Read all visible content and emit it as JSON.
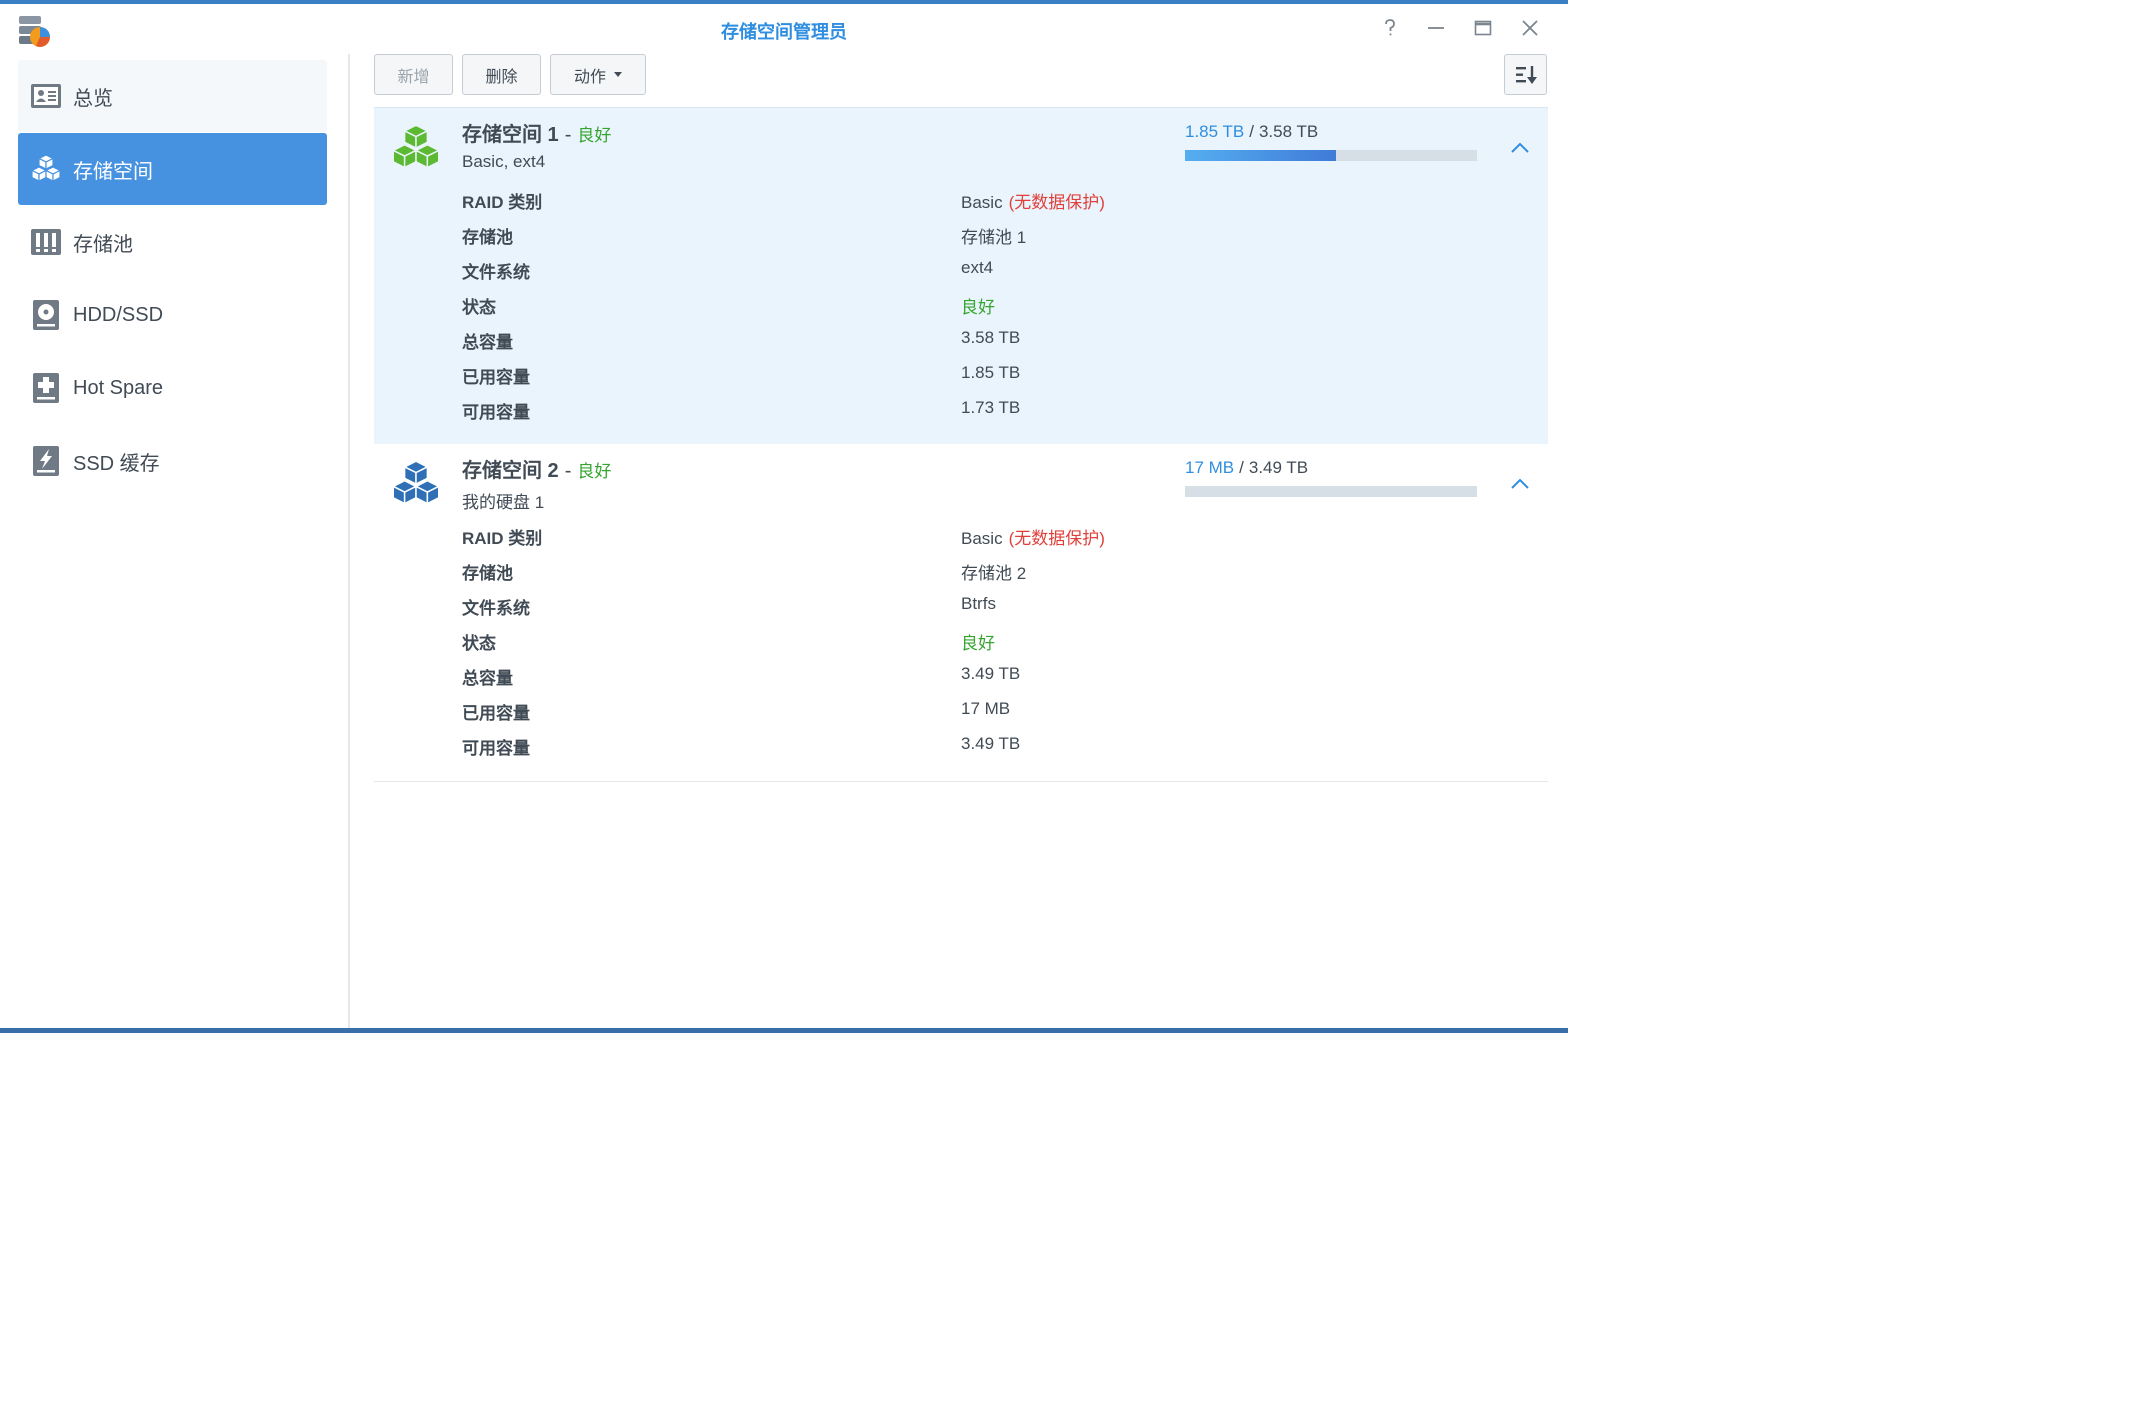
{
  "window": {
    "title": "存储空间管理员"
  },
  "sidebar": {
    "items": [
      {
        "label": "总览",
        "icon": "overview-icon"
      },
      {
        "label": "存储空间",
        "icon": "volume-icon"
      },
      {
        "label": "存储池",
        "icon": "storage-pool-icon"
      },
      {
        "label": "HDD/SSD",
        "icon": "hdd-icon"
      },
      {
        "label": "Hot Spare",
        "icon": "hot-spare-icon"
      },
      {
        "label": "SSD 缓存",
        "icon": "ssd-cache-icon"
      }
    ],
    "active_index": 1
  },
  "toolbar": {
    "create_label": "新增",
    "delete_label": "删除",
    "action_label": "动作"
  },
  "volumes": [
    {
      "name": "存储空间 1",
      "separator": "-",
      "status": "良好",
      "description": "Basic, ext4",
      "used": "1.85 TB",
      "slash": "/",
      "total": "3.58 TB",
      "usage_fraction": 0.517,
      "icon_color": "#5cb932",
      "rows": [
        {
          "key": "RAID 类别",
          "value": "Basic",
          "note": "(无数据保护)"
        },
        {
          "key": "存储池",
          "value": "存储池 1"
        },
        {
          "key": "文件系统",
          "value": "ext4"
        },
        {
          "key": "状态",
          "value": "良好"
        },
        {
          "key": "总容量",
          "value": "3.58 TB"
        },
        {
          "key": "已用容量",
          "value": "1.85 TB"
        },
        {
          "key": "可用容量",
          "value": "1.73 TB"
        }
      ]
    },
    {
      "name": "存储空间 2",
      "separator": "-",
      "status": "良好",
      "description": "我的硬盘 1",
      "used": "17 MB",
      "slash": "/",
      "total": "3.49 TB",
      "usage_fraction": 0.0,
      "icon_color": "#2f6fb6",
      "rows": [
        {
          "key": "RAID 类别",
          "value": "Basic",
          "note": "(无数据保护)"
        },
        {
          "key": "存储池",
          "value": "存储池 2"
        },
        {
          "key": "文件系统",
          "value": "Btrfs"
        },
        {
          "key": "状态",
          "value": "良好"
        },
        {
          "key": "总容量",
          "value": "3.49 TB"
        },
        {
          "key": "已用容量",
          "value": "17 MB"
        },
        {
          "key": "可用容量",
          "value": "3.49 TB"
        }
      ]
    }
  ],
  "colors": {
    "accent": "#4692e1",
    "good": "#35a52f",
    "warning": "#e0403b",
    "title": "#2f8ee0"
  }
}
